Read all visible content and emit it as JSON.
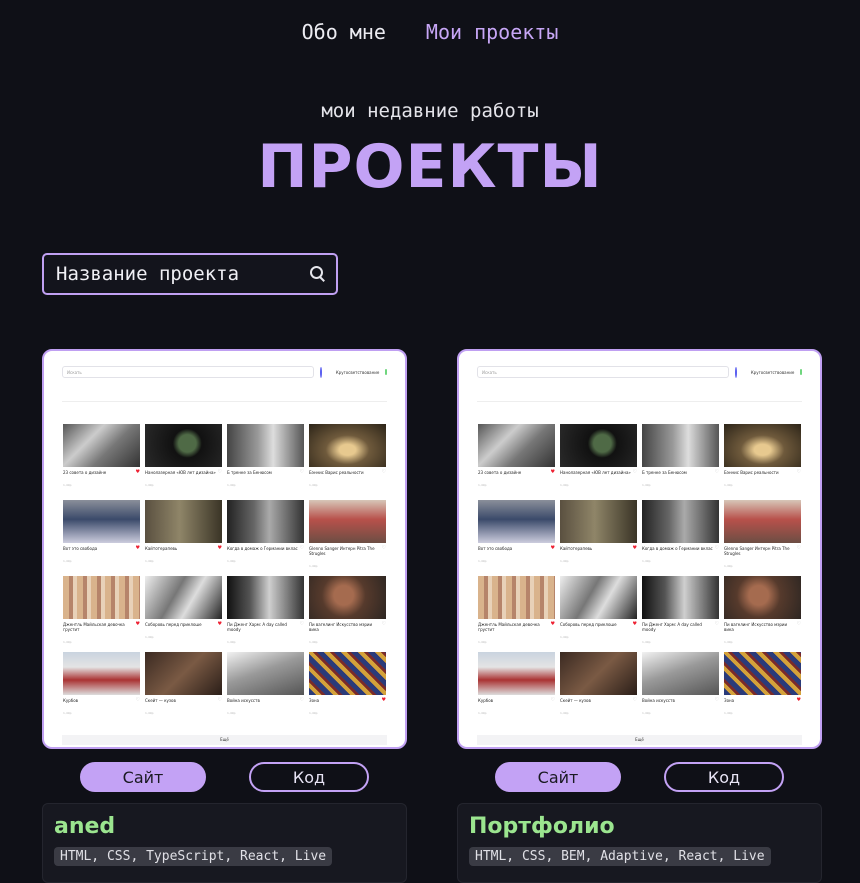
{
  "nav": {
    "about": "Обо мне",
    "projects": "Мои проекты"
  },
  "hero": {
    "subtitle": "мои недавние работы",
    "title": "ПРОЕКТЫ"
  },
  "search": {
    "placeholder": "Название проекта"
  },
  "colors": {
    "accent": "#c3a2f5",
    "project_title": "#9be58f",
    "background": "#0f1017"
  },
  "preview": {
    "search_placeholder": "Искать",
    "toggle_label": "Кругосветствование",
    "footer_label": "Ещё",
    "tiles": [
      {
        "caption": "23 совета о дизайне",
        "liked": true,
        "meta": "1,49р"
      },
      {
        "caption": "Нанолазерная «ЮВ лет дизайна»",
        "liked": false,
        "meta": "1,49р"
      },
      {
        "caption": "Б тренке за Бенюсом",
        "liked": false,
        "meta": "1,49р"
      },
      {
        "caption": "Бэннис Варис реальности",
        "liked": false,
        "meta": "1,49р"
      },
      {
        "caption": "Вот это свобода",
        "liked": true,
        "meta": "1,49р"
      },
      {
        "caption": "Кайтотерапевь",
        "liked": true,
        "meta": "1,49р"
      },
      {
        "caption": "Когда в домаж о Германии вклас",
        "liked": false,
        "meta": "1,49р"
      },
      {
        "caption": "Glenno Sanger Интерн Pitra The Strugles",
        "liked": false,
        "meta": "1,49р"
      },
      {
        "caption": "Джентль Майльская девочка грустит",
        "liked": true,
        "meta": "1,49р"
      },
      {
        "caption": "Соборовь перед приклоше",
        "liked": true,
        "meta": "1,49р"
      },
      {
        "caption": "Пи Дженг Харм: A day called moody",
        "liked": false,
        "meta": "1,49р"
      },
      {
        "caption": "Пи вагелинг Искусство мэрии вика",
        "liked": false,
        "meta": "1,49р"
      },
      {
        "caption": "Курбов",
        "liked": false,
        "meta": "1,49р"
      },
      {
        "caption": "Скейт — кузов",
        "liked": false,
        "meta": "1,49р"
      },
      {
        "caption": "Война искусств",
        "liked": false,
        "meta": "1,49р"
      },
      {
        "caption": "Зона",
        "liked": true,
        "meta": "1,49р"
      }
    ]
  },
  "projects": [
    {
      "title": "aned",
      "site_label": "Сайт",
      "code_label": "Код",
      "tags": "HTML, CSS, TypeScript, React, Live"
    },
    {
      "title": "Портфолио",
      "site_label": "Сайт",
      "code_label": "Код",
      "tags": "HTML, CSS, BEM, Adaptive, React, Live"
    }
  ]
}
